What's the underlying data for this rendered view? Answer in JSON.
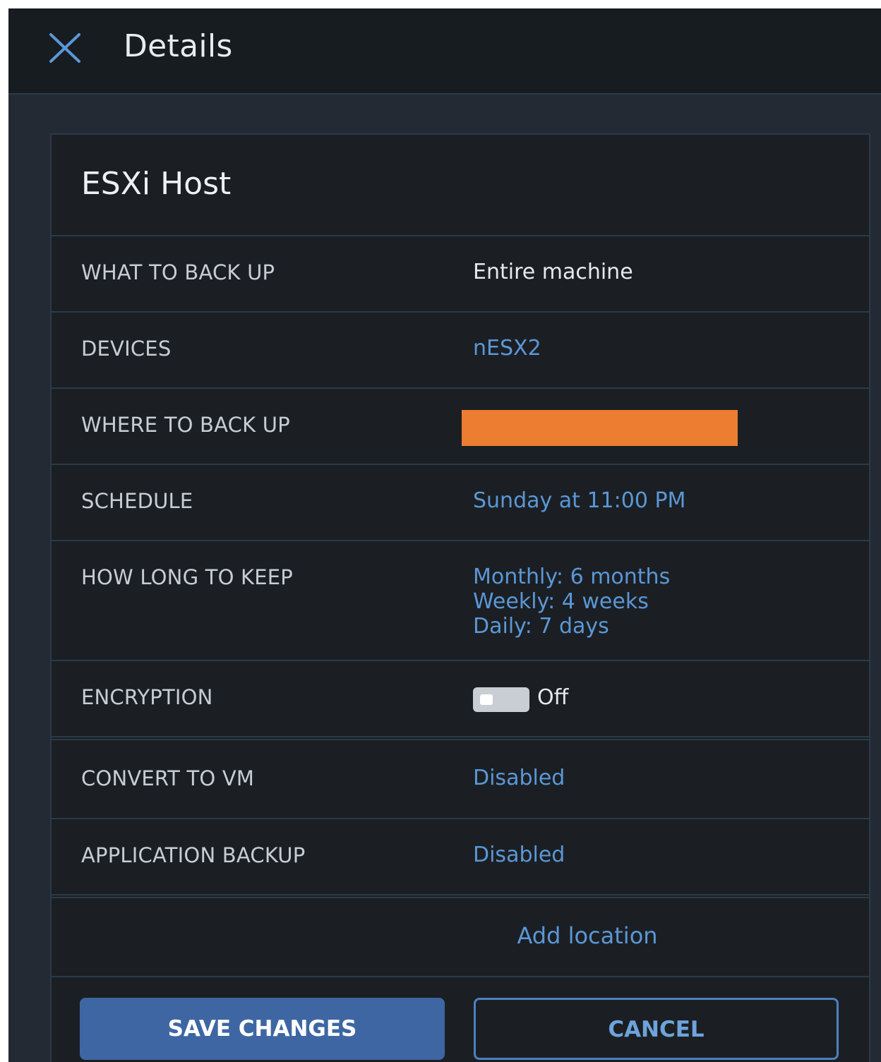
{
  "header": {
    "title": "Details"
  },
  "card": {
    "title": "ESXi Host",
    "rows": {
      "what_to_back_up": {
        "label": "WHAT TO BACK UP",
        "value": "Entire machine"
      },
      "devices": {
        "label": "DEVICES",
        "value": "nESX2"
      },
      "where_to_back_up": {
        "label": "WHERE TO BACK UP"
      },
      "schedule": {
        "label": "SCHEDULE",
        "value": "Sunday at 11:00 PM"
      },
      "how_long_to_keep": {
        "label": "HOW LONG TO KEEP",
        "values": [
          "Monthly: 6 months",
          "Weekly: 4 weeks",
          "Daily: 7 days"
        ]
      },
      "encryption": {
        "label": "ENCRYPTION",
        "state": "Off"
      },
      "convert_to_vm": {
        "label": "CONVERT TO VM",
        "value": "Disabled"
      },
      "application_backup": {
        "label": "APPLICATION BACKUP",
        "value": "Disabled"
      }
    },
    "add_location": "Add location"
  },
  "buttons": {
    "save": "SAVE CHANGES",
    "cancel": "CANCEL"
  },
  "colors": {
    "accent": "#5b97d6",
    "primary_button": "#3e66a3",
    "redaction": "#ed7d31"
  }
}
